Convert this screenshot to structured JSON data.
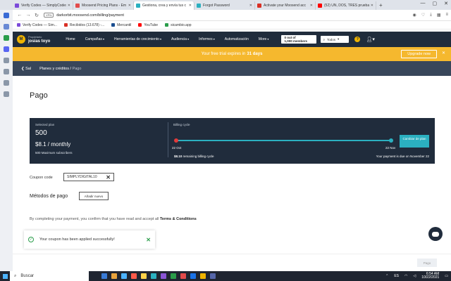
{
  "browser": {
    "tabs": [
      {
        "title": "Verify Codes — SimplyCodes",
        "color": "#7b4ad9"
      },
      {
        "title": "Moosend Pricing Plans - Em",
        "color": "#e24b4b"
      },
      {
        "title": "Gestiona, crea y envía tus c",
        "color": "#2bb0c0",
        "active": true
      },
      {
        "title": "Forgot Password",
        "color": "#2bb0c0"
      },
      {
        "title": "Activate your Moosend acc",
        "color": "#d93025"
      },
      {
        "title": "(52) UN, DOS, TRES pruebas",
        "color": "#ff0000"
      }
    ],
    "newtab": "+",
    "url": "darkorbit.moosend.com/billing/payment",
    "vpn": "VPN",
    "bookmarks": [
      {
        "label": "Verify Codes — Sim...",
        "color": "#7b4ad9"
      },
      {
        "label": "Recibidos (13.678) -...",
        "color": "#d93025"
      },
      {
        "label": "Mercantil",
        "color": "#1a4d8f"
      },
      {
        "label": "YouTube",
        "color": "#ff0000"
      },
      {
        "label": "sicambio.app",
        "color": "#2a9d4a"
      }
    ]
  },
  "app": {
    "account_role": "Propietario",
    "account_name": "josias toyo",
    "logo_letter": "M",
    "menu": [
      "Home",
      "Campañas",
      "Herramientas de crecimiento",
      "Audiencia",
      "Informes",
      "Automatización",
      "More"
    ],
    "subscribers_count": "0 out of",
    "subscribers_total": "1,000 members",
    "search_scope": "Todos",
    "help": "?"
  },
  "trial": {
    "message": "Your free trial expires in",
    "days": "31 days",
    "upgrade_label": "Upgrade now"
  },
  "breadcrumb": {
    "back": "Sal",
    "parent": "Planes y créditos",
    "sep": "/",
    "current": "Pago"
  },
  "page": {
    "title": "Pago",
    "plan": {
      "selected_label": "Selected plan",
      "subscribers": "500",
      "price": "$8.1 / monthly",
      "max_label": "500 Maximum subscribers",
      "cycle_label": "Billing cycle",
      "start_date": "22 Oct",
      "end_date": "22 Nov",
      "remaining_amount": "$8.10",
      "remaining_label": "remaining billing cycle",
      "due_text": "Your payment is due on November 22",
      "change_label": "Cambiar de plan"
    },
    "coupon_label": "Coupon code",
    "coupon_value": "SIMPLYDIGITAL10",
    "methods_title": "Métodos de pago",
    "add_new_label": "Añadir nuevo",
    "terms_prefix": "By completing your payment, you confirm that you have read and accept all",
    "terms_link": "Terms & Conditions",
    "toast_message": "Your coupon has been applied successfully!",
    "pay_label": "Pago"
  },
  "taskbar": {
    "search": "Buscar",
    "lang": "ES",
    "time": "6:54 AM",
    "date": "10/22/2021",
    "apps": [
      "#3a7bd5",
      "#e8a33d",
      "#4cb3ff",
      "#ff5a4a",
      "#ffd24a",
      "#2bb0c0",
      "#8a55d6",
      "#2a9d4a",
      "#e24b4b",
      "#1a73e8",
      "#f0b400",
      "#5566aa"
    ]
  }
}
